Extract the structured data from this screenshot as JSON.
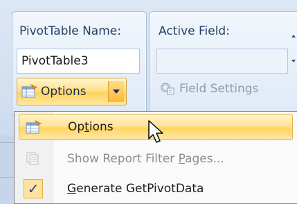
{
  "ribbon": {
    "pivot_group": {
      "name_label": "PivotTable Name:",
      "name_value": "PivotTable3",
      "options_button_label": "Options",
      "options_button_icon": "pivot-options-icon"
    },
    "active_field_group": {
      "label": "Active Field:",
      "value": "",
      "field_settings_label": "Field Settings",
      "field_settings_icon": "field-settings-icon"
    }
  },
  "menu": {
    "items": [
      {
        "pre": "Op",
        "accel": "t",
        "post": "ions",
        "icon": "pivot-options-icon",
        "state": "highlighted"
      },
      {
        "pre": "Show Repor",
        "accel": "t",
        "post": " Filter ",
        "accel2": "P",
        "post2": "ages...",
        "icon": "report-filter-pages-icon",
        "state": "disabled"
      },
      {
        "pre": "",
        "accel": "G",
        "post": "enerate GetPivotData",
        "icon": "checkmark-icon",
        "state": "checked"
      }
    ]
  },
  "colors": {
    "highlight": "#ffe08a",
    "ribbon_bg": "#d3e0f1",
    "label_text": "#243f66"
  }
}
